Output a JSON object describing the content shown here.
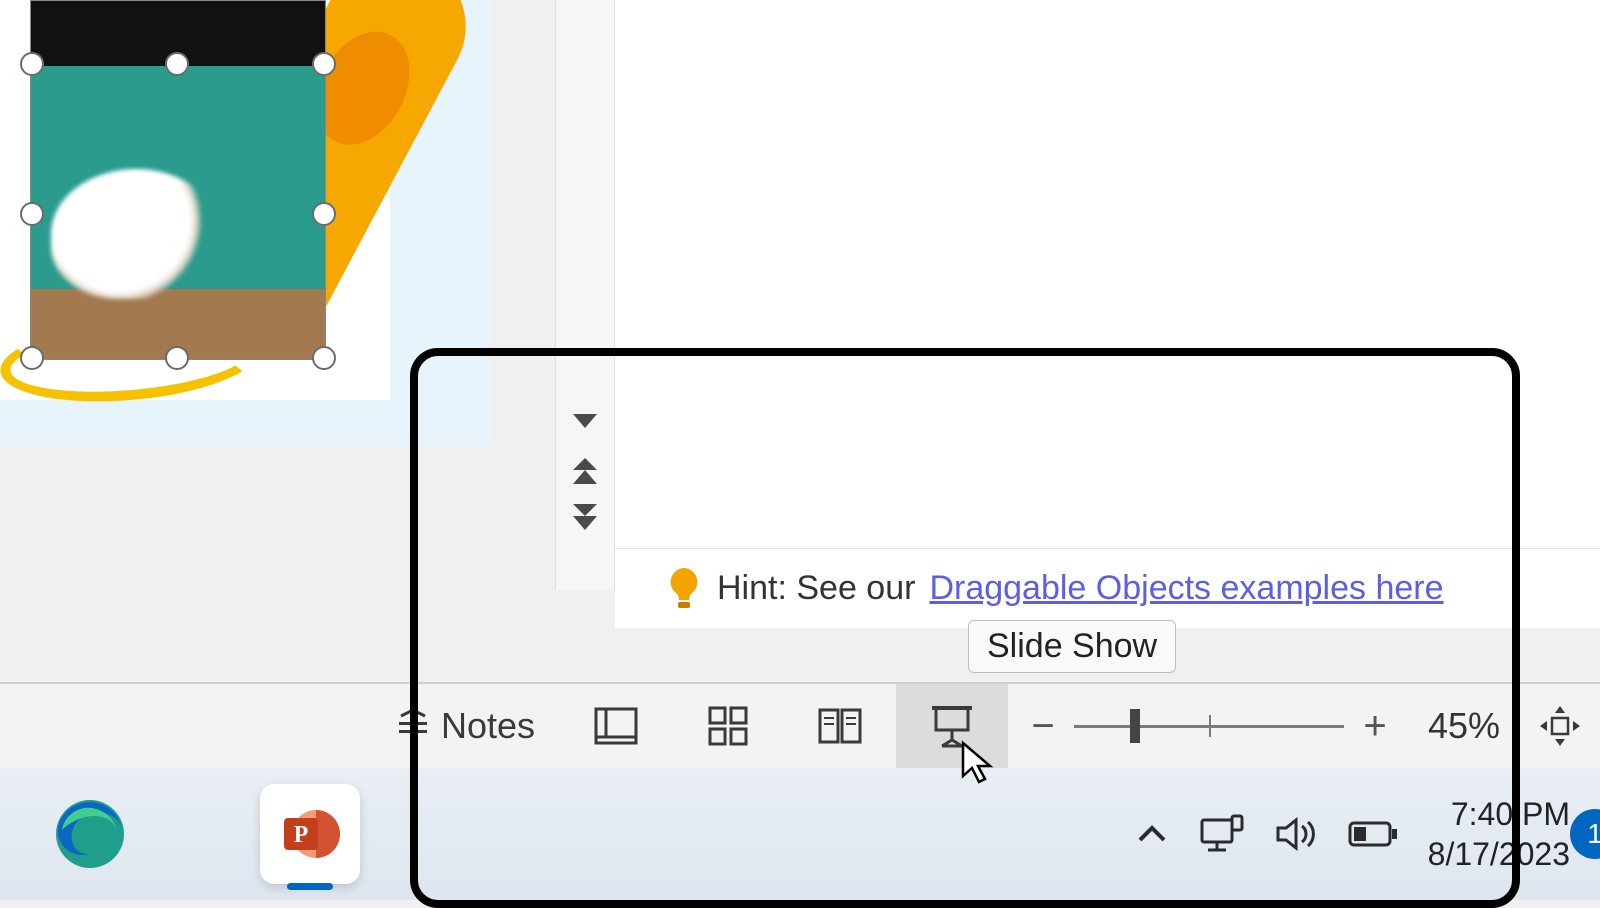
{
  "hint": {
    "prefix": "Hint: See our ",
    "link_text": "Draggable Objects examples here"
  },
  "tooltip": {
    "label": "Slide Show"
  },
  "status_bar": {
    "notes_label": "Notes",
    "zoom_percent": "45%"
  },
  "taskbar": {
    "time": "7:40 PM",
    "date": "8/17/2023",
    "notification_count": "1"
  }
}
